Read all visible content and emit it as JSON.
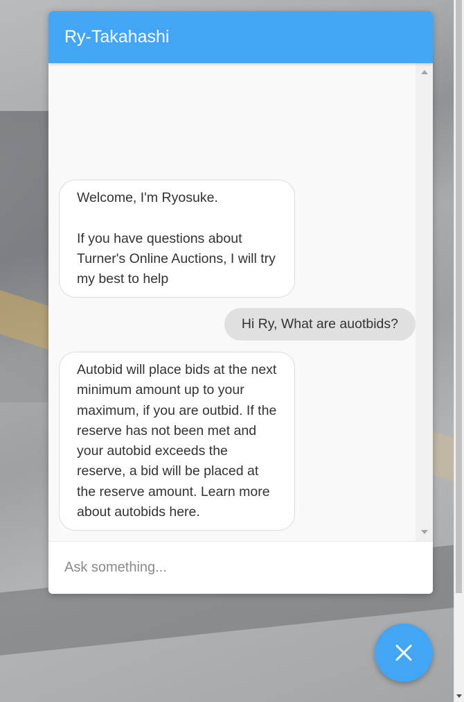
{
  "chat": {
    "title": "Ry-Takahashi",
    "messages": [
      {
        "from": "bot",
        "text": "Welcome, I'm Ryosuke.\n\nIf you have questions about Turner's Online Auctions, I will try my best to help"
      },
      {
        "from": "user",
        "text": "Hi Ry, What are auotbids?"
      },
      {
        "from": "bot",
        "text": "Autobid will place bids at the next minimum amount up to your maximum, if you are outbid. If the reserve has not been met and your autobid exceeds the reserve, a bid will be placed at the reserve amount. Learn more about autobids here."
      }
    ],
    "input": {
      "placeholder": "Ask something...",
      "value": ""
    }
  },
  "icons": {
    "close": "close-icon"
  },
  "colors": {
    "accent": "#42a5f5",
    "header_text": "#ffffff",
    "user_bubble": "#e0e0e0"
  }
}
